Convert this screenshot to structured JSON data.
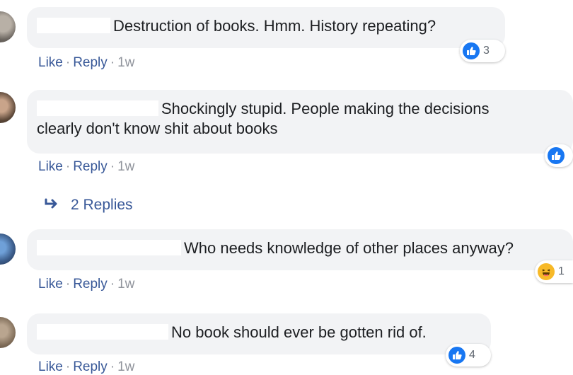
{
  "comments": [
    {
      "text": "Destruction of books. Hmm. History repeating?",
      "actions": {
        "like": "Like",
        "reply": "Reply",
        "time": "1w"
      },
      "reactions": {
        "icon": "like-icon",
        "count": "3"
      }
    },
    {
      "text_line1": "Shockingly stupid. People making the decisions",
      "text_line2": "clearly don't know shit about books",
      "actions": {
        "like": "Like",
        "reply": "Reply",
        "time": "1w"
      },
      "reactions": {
        "icon": "like-icon",
        "count": ""
      }
    },
    {
      "text": "Who needs knowledge of other places anyway?",
      "actions": {
        "like": "Like",
        "reply": "Reply",
        "time": "1w"
      },
      "reactions": {
        "icon": "haha-icon",
        "count": "1"
      }
    },
    {
      "text": "No book should ever be gotten rid of.",
      "actions": {
        "like": "Like",
        "reply": "Reply",
        "time": "1w"
      },
      "reactions": {
        "icon": "like-icon",
        "count": "4"
      }
    }
  ],
  "replies_link": {
    "label": "2 Replies",
    "icon": "reply-arrow-icon"
  },
  "colors": {
    "bubble": "#f2f3f5",
    "link": "#385898",
    "like_blue": "#1877f2",
    "haha_yellow": "#f7b928"
  },
  "separator": "·"
}
